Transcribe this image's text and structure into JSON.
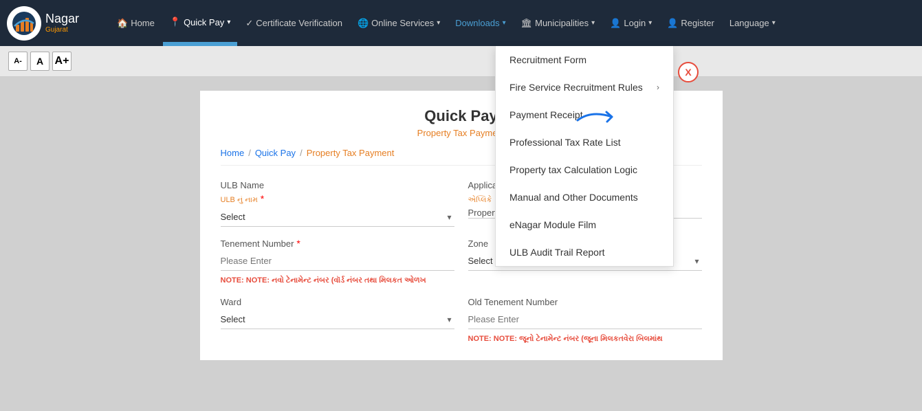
{
  "brand": {
    "name": "Nagar",
    "subtitle": "Gujarat"
  },
  "navbar": {
    "items": [
      {
        "id": "home",
        "icon": "🏠",
        "label": "Home",
        "has_arrow": false
      },
      {
        "id": "quick-pay",
        "icon": "📍",
        "label": "Quick Pay",
        "has_arrow": true,
        "active": true
      },
      {
        "id": "cert-verification",
        "icon": "✓",
        "label": "Certificate Verification",
        "has_arrow": false
      },
      {
        "id": "online-services",
        "icon": "🌐",
        "label": "Online Services",
        "has_arrow": true
      },
      {
        "id": "downloads",
        "icon": "",
        "label": "Downloads",
        "has_arrow": true,
        "active_dropdown": true
      },
      {
        "id": "municipalities",
        "icon": "🏛",
        "label": "Municipalities",
        "has_arrow": true
      },
      {
        "id": "login",
        "icon": "👤",
        "label": "Login",
        "has_arrow": true
      },
      {
        "id": "register",
        "icon": "👤",
        "label": "Register",
        "has_arrow": false
      },
      {
        "id": "language",
        "icon": "",
        "label": "Language",
        "has_arrow": true
      }
    ]
  },
  "font_controls": {
    "decrease": "A-",
    "normal": "A",
    "increase": "A+"
  },
  "page": {
    "title": "Quick Pay",
    "subtitle": "Property Tax Payment"
  },
  "breadcrumb": {
    "items": [
      {
        "label": "Home",
        "link": true
      },
      {
        "label": "Quick Pay",
        "link": true
      },
      {
        "label": "Property Tax Payment",
        "link": false,
        "current": true
      }
    ]
  },
  "form": {
    "ulb_name_label": "ULB Name",
    "ulb_name_label_gujarati": "ULB નું નામ",
    "ulb_select_placeholder": "Select",
    "application_number_label": "Application",
    "application_label_gujarati": "એપ્લિકે",
    "property_type_label": "Property",
    "tenement_number_label": "Tenement Number",
    "tenement_placeholder": "Please Enter",
    "zone_label": "Zone",
    "zone_select_placeholder": "Select",
    "ward_label": "Ward",
    "ward_select_placeholder": "Select",
    "old_tenement_label": "Old Tenement Number",
    "old_tenement_placeholder": "Please Enter",
    "note_new": "NOTE: નવો ટેનામેન્ટ નંબર (વૉર્ડ નંબર તથા મિલકત ઓળખ",
    "note_old": "NOTE: જૂનો ટેનામેન્ટ નંબર (જૂના મિલકતવેરા બિલમાંથ"
  },
  "dropdown": {
    "title": "Downloads",
    "items": [
      {
        "id": "recruitment-form",
        "label": "Recruitment Form",
        "has_sub": false
      },
      {
        "id": "fire-service",
        "label": "Fire Service Recruitment Rules",
        "has_sub": true
      },
      {
        "id": "payment-receipt",
        "label": "Payment Receipt",
        "has_sub": false
      },
      {
        "id": "professional-tax",
        "label": "Professional Tax Rate List",
        "has_sub": false
      },
      {
        "id": "property-calc",
        "label": "Property tax Calculation Logic",
        "has_sub": false
      },
      {
        "id": "manual-docs",
        "label": "Manual and Other Documents",
        "has_sub": false
      },
      {
        "id": "enagar-film",
        "label": "eNagar Module Film",
        "has_sub": false
      },
      {
        "id": "ulb-audit",
        "label": "ULB Audit Trail Report",
        "has_sub": false
      }
    ]
  },
  "colors": {
    "navbar_bg": "#1e2a3a",
    "active_underline": "#4a9fd4",
    "accent": "#e67e22",
    "link": "#1a73e8",
    "close_btn": "#e74c3c"
  }
}
